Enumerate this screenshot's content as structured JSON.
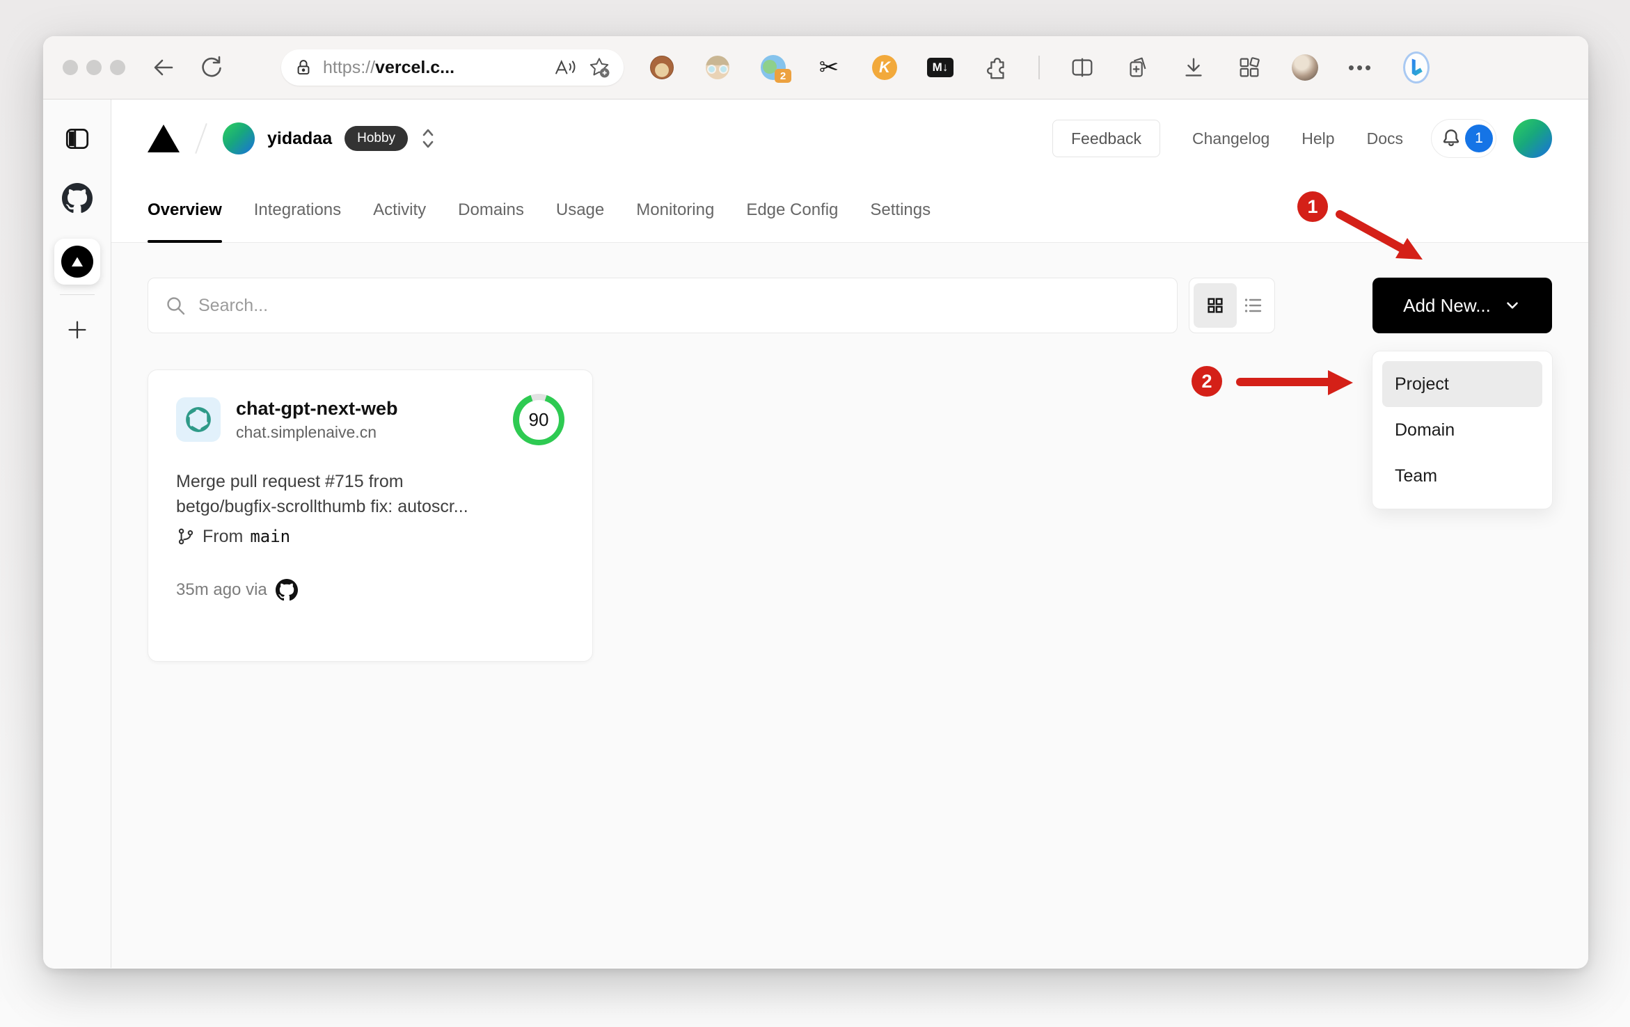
{
  "browser": {
    "url_scheme": "https://",
    "url_host": "vercel.c...",
    "translate_badge": "2",
    "scissors_glyph": "✂",
    "keylol_label": "K",
    "markdown_label": "M↓",
    "dots_label": "•••"
  },
  "header": {
    "team_name": "yidadaa",
    "plan_badge": "Hobby",
    "feedback_label": "Feedback",
    "links": [
      "Changelog",
      "Help",
      "Docs"
    ],
    "notification_count": "1"
  },
  "tabs": [
    {
      "label": "Overview",
      "active": true
    },
    {
      "label": "Integrations",
      "active": false
    },
    {
      "label": "Activity",
      "active": false
    },
    {
      "label": "Domains",
      "active": false
    },
    {
      "label": "Usage",
      "active": false
    },
    {
      "label": "Monitoring",
      "active": false
    },
    {
      "label": "Edge Config",
      "active": false
    },
    {
      "label": "Settings",
      "active": false
    }
  ],
  "toolbar": {
    "search_placeholder": "Search...",
    "add_new_label": "Add New..."
  },
  "dropdown": {
    "items": [
      "Project",
      "Domain",
      "Team"
    ],
    "selected": "Project"
  },
  "project_card": {
    "name": "chat-gpt-next-web",
    "domain": "chat.simplenaive.cn",
    "score": "90",
    "commit_line1": "Merge pull request #715 from",
    "commit_line2": "betgo/bugfix-scrollthumb fix: autoscr...",
    "branch_prefix": "From",
    "branch_name": "main",
    "meta_text": "35m ago via"
  },
  "annotations": {
    "step1": "1",
    "step2": "2"
  },
  "colors": {
    "accent_green": "#2eca52",
    "annotation_red": "#d42018",
    "notification_blue": "#1574e6",
    "button_black": "#000000"
  }
}
